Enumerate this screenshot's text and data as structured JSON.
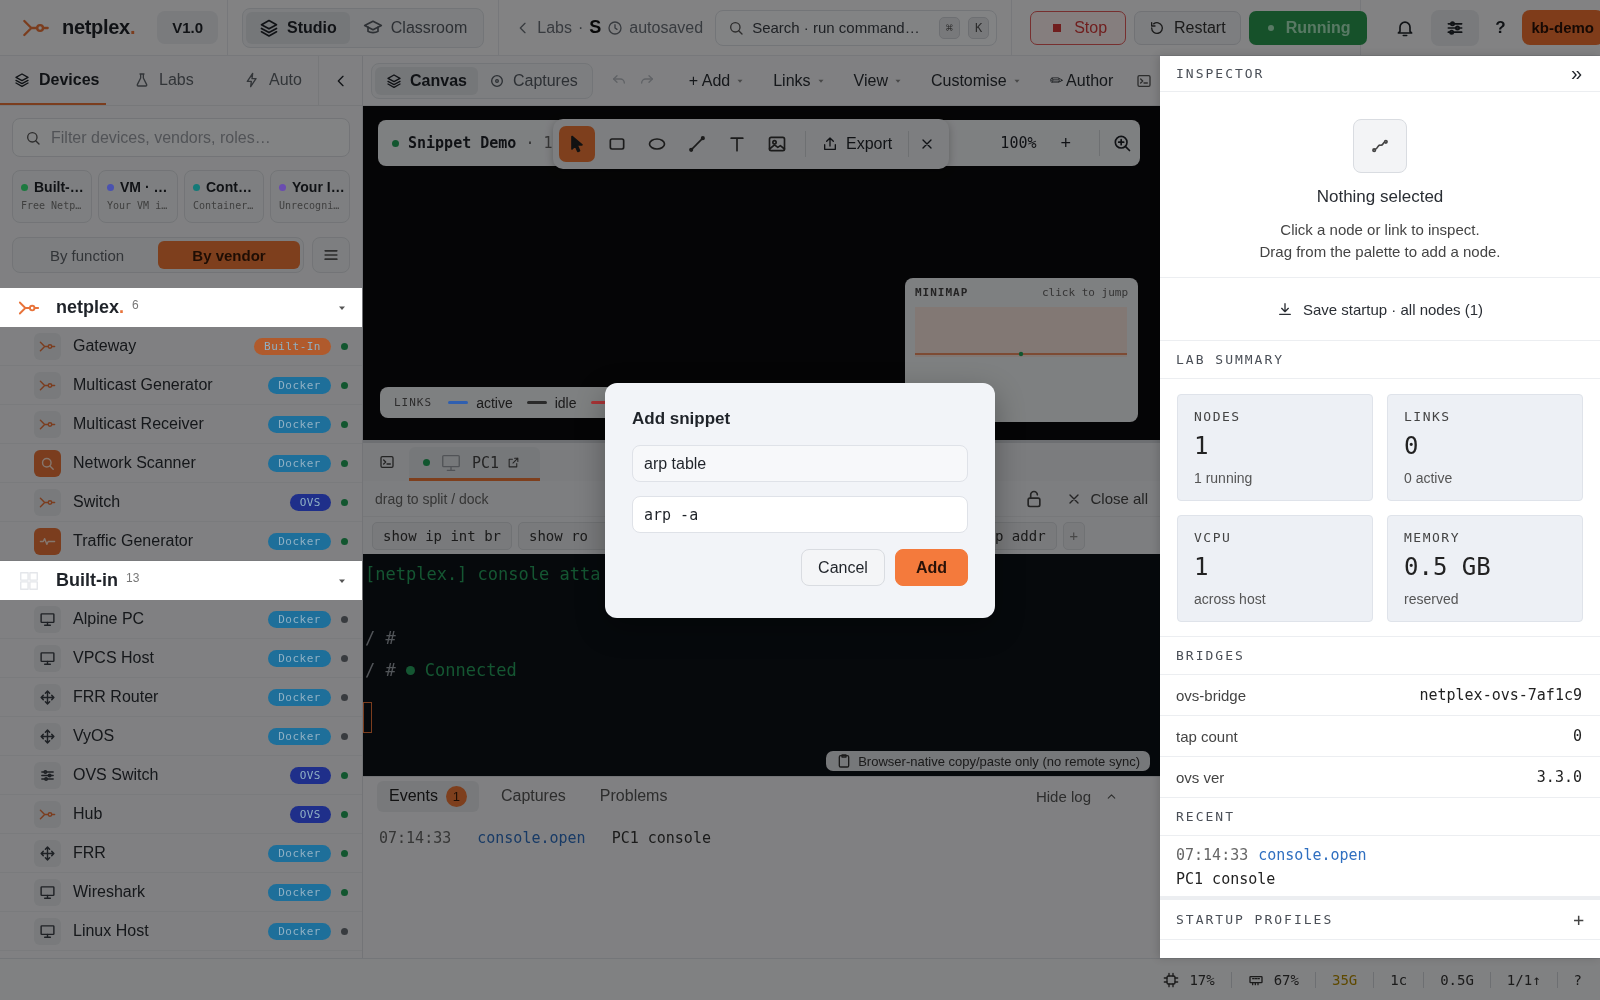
{
  "topbar": {
    "brand": {
      "name": "netplex",
      "mark": "."
    },
    "version": "V1.0",
    "modes": [
      {
        "kind": "studio",
        "label": "Studio",
        "selected": true
      },
      {
        "kind": "classroom",
        "label": "Classroom",
        "selected": false
      }
    ],
    "breadcrumb": {
      "back": "Labs",
      "separator": "·",
      "lab": "S",
      "status": "autosaved"
    },
    "search": {
      "placeholder": "Search · run command…",
      "keys": [
        "⌘",
        "K"
      ]
    },
    "actions": [
      {
        "kind": "stop",
        "label": "Stop"
      },
      {
        "kind": "restart",
        "label": "Restart"
      },
      {
        "kind": "running",
        "label": "Running"
      }
    ],
    "help": "?",
    "user": "kb-demo"
  },
  "sidebar": {
    "tabs": [
      {
        "kind": "devices",
        "label": "Devices",
        "selected": true
      },
      {
        "kind": "labs",
        "label": "Labs",
        "selected": false
      },
      {
        "kind": "auto",
        "label": "Auto",
        "selected": false
      }
    ],
    "filter": {
      "placeholder": "Filter devices, vendors, roles…"
    },
    "sources": [
      {
        "title": "Built-…",
        "subtitle": "Free Netp…",
        "color": "#1e7a40"
      },
      {
        "title": "VM · …",
        "subtitle": "Your VM i…",
        "color": "#4a52b0"
      },
      {
        "title": "Cont…",
        "subtitle": "Container…",
        "color": "#147a78"
      },
      {
        "title": "Your I…",
        "subtitle": "Unrecogni…",
        "color": "#6a4cb0"
      }
    ],
    "grouping": [
      {
        "label": "By function",
        "selected": false
      },
      {
        "label": "By vendor",
        "selected": true
      }
    ],
    "groups": [
      {
        "kind": "vendor",
        "name": "netplex",
        "mark": ".",
        "count": "6",
        "expanded": true,
        "devices": [
          {
            "kind": "logo",
            "name": "Gateway",
            "badge": {
              "label": "Built-In",
              "color": "#b05a2c"
            },
            "online": true
          },
          {
            "kind": "logo",
            "name": "Multicast Generator",
            "badge": {
              "label": "Docker",
              "color": "#1e6f9a"
            },
            "online": true
          },
          {
            "kind": "logo",
            "name": "Multicast Receiver",
            "badge": {
              "label": "Docker",
              "color": "#1e6f9a"
            },
            "online": true
          },
          {
            "kind": "scanner",
            "name": "Network Scanner",
            "badge": {
              "label": "Docker",
              "color": "#1e6f9a"
            },
            "online": true
          },
          {
            "kind": "logo",
            "name": "Switch",
            "badge": {
              "label": "OVS",
              "color": "#1f2f8a"
            },
            "online": true
          },
          {
            "kind": "traffic",
            "name": "Traffic Generator",
            "badge": {
              "label": "Docker",
              "color": "#1e6f9a"
            },
            "online": true
          }
        ]
      },
      {
        "kind": "builtin",
        "name": "Built-in",
        "count": "13",
        "expanded": true,
        "devices": [
          {
            "kind": "pc",
            "name": "Alpine PC",
            "badge": {
              "label": "Docker",
              "color": "#1e6f9a"
            },
            "online": false
          },
          {
            "kind": "pc",
            "name": "VPCS Host",
            "badge": {
              "label": "Docker",
              "color": "#1e6f9a"
            },
            "online": false
          },
          {
            "kind": "router",
            "name": "FRR Router",
            "badge": {
              "label": "Docker",
              "color": "#1e6f9a"
            },
            "online": false
          },
          {
            "kind": "router",
            "name": "VyOS",
            "badge": {
              "label": "Docker",
              "color": "#1e6f9a"
            },
            "online": false
          },
          {
            "kind": "switch",
            "name": "OVS Switch",
            "badge": {
              "label": "OVS",
              "color": "#1f2f8a"
            },
            "online": true
          },
          {
            "kind": "logo",
            "name": "Hub",
            "badge": {
              "label": "OVS",
              "color": "#1f2f8a"
            },
            "online": true
          },
          {
            "kind": "router",
            "name": "FRR",
            "badge": {
              "label": "Docker",
              "color": "#1e6f9a"
            },
            "online": true
          },
          {
            "kind": "pc",
            "name": "Wireshark",
            "badge": {
              "label": "Docker",
              "color": "#1e6f9a"
            },
            "online": true
          },
          {
            "kind": "pc",
            "name": "Linux Host",
            "badge": {
              "label": "Docker",
              "color": "#1e6f9a"
            },
            "online": false
          }
        ]
      }
    ]
  },
  "toolbar": {
    "views": [
      {
        "kind": "canvas",
        "label": "Canvas",
        "selected": true
      },
      {
        "kind": "captures",
        "label": "Captures",
        "selected": false
      }
    ],
    "menus": [
      {
        "label": "+ Add",
        "dropdown": true
      },
      {
        "label": "Links",
        "dropdown": true
      },
      {
        "label": "View",
        "dropdown": true
      },
      {
        "label": "Customise",
        "dropdown": true
      },
      {
        "label": "✏ Author",
        "dropdown": false
      }
    ]
  },
  "canvas": {
    "lab": {
      "name": "Snippet Demo",
      "meta": "· 1",
      "online": true
    },
    "tools": [
      {
        "kind": "select",
        "selected": true
      },
      {
        "kind": "rect",
        "selected": false
      },
      {
        "kind": "ellipse",
        "selected": false
      },
      {
        "kind": "line",
        "selected": false
      },
      {
        "kind": "text",
        "selected": false
      },
      {
        "kind": "image",
        "selected": false
      }
    ],
    "export": "Export",
    "zoom": "100%",
    "zoom_in": "+",
    "minimap": {
      "title": "MINIMAP",
      "hint": "click to jump"
    },
    "legend": {
      "title": "LINKS",
      "items": [
        {
          "label": "active",
          "color": "#2f5fb0"
        },
        {
          "label": "idle",
          "color": "#2a2a2a"
        },
        {
          "color": "#a83436"
        }
      ]
    }
  },
  "terminal": {
    "tabs": [
      {
        "label": "PC1",
        "selected": true,
        "online": true
      }
    ],
    "hint": "drag to split / dock",
    "close_all": "Close all",
    "snippets": [
      "show ip int br",
      "show ro"
    ],
    "snippets_right": [
      "p addr"
    ],
    "add": "+",
    "lines": [
      {
        "kind": "info",
        "text": "[netplex.] console atta"
      },
      {
        "kind": "prompt",
        "prompt": "/ #"
      },
      {
        "kind": "status",
        "prompt": "/ #",
        "text": "Connected"
      }
    ],
    "note": "Browser-native copy/paste only (no remote sync)"
  },
  "log": {
    "tabs": [
      {
        "label": "Events",
        "count": "1",
        "selected": true
      },
      {
        "label": "Captures",
        "selected": false
      },
      {
        "label": "Problems",
        "selected": false
      }
    ],
    "toggle": "Hide log",
    "entries": [
      {
        "time": "07:14:33",
        "event": "console.open",
        "detail": "PC1 console"
      }
    ]
  },
  "inspector": {
    "title": "INSPECTOR",
    "collapse": "»",
    "empty": {
      "title": "Nothing selected",
      "lines": [
        "Click a node or link to inspect.",
        "Drag from the palette to add a node."
      ]
    },
    "save": "Save startup · all nodes (1)",
    "summary_title": "LAB SUMMARY",
    "stats": [
      {
        "label": "NODES",
        "value": "1",
        "sub": "1 running"
      },
      {
        "label": "LINKS",
        "value": "0",
        "sub": "0 active"
      },
      {
        "label": "VCPU",
        "value": "1",
        "sub": "across host"
      },
      {
        "label": "MEMORY",
        "value": "0.5 GB",
        "sub": "reserved"
      }
    ],
    "bridges_title": "BRIDGES",
    "bridges": [
      {
        "key": "ovs-bridge",
        "value": "netplex-ovs-7af1c9"
      },
      {
        "key": "tap count",
        "value": "0"
      },
      {
        "key": "ovs ver",
        "value": "3.3.0"
      }
    ],
    "recent_title": "RECENT",
    "recent": [
      {
        "time": "07:14:33",
        "event": "console.open",
        "detail": "PC1 console"
      }
    ],
    "profiles_title": "STARTUP PROFILES",
    "profiles_add": "+"
  },
  "modal": {
    "title": "Add snippet",
    "fields": [
      {
        "kind": "name",
        "value": "arp table"
      },
      {
        "kind": "command",
        "value": "arp -a"
      }
    ],
    "buttons": [
      {
        "kind": "secondary",
        "label": "Cancel"
      },
      {
        "kind": "primary",
        "label": "Add"
      }
    ]
  },
  "status_bar": [
    {
      "kind": "cpu",
      "text": "17%"
    },
    {
      "kind": "memory",
      "text": "67%"
    },
    {
      "kind": "warn",
      "text": "35G"
    },
    {
      "kind": "plain",
      "text": "1c"
    },
    {
      "kind": "plain",
      "text": "0.5G"
    },
    {
      "kind": "plain",
      "text": "1/1↑"
    },
    {
      "kind": "plain",
      "text": "?"
    }
  ]
}
